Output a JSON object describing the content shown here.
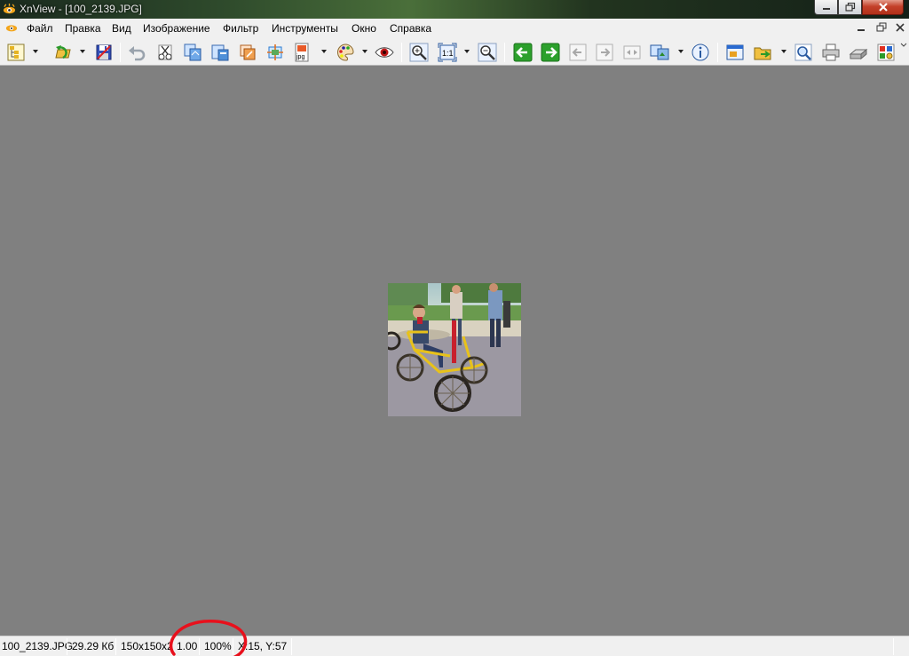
{
  "window": {
    "title": "XnView - [100_2139.JPG]",
    "buttons": {
      "minimize": "minimize-icon",
      "maximize": "restore-icon",
      "close": "close-icon"
    }
  },
  "menubar": {
    "items": [
      "Файл",
      "Правка",
      "Вид",
      "Изображение",
      "Фильтр",
      "Инструменты",
      "Окно",
      "Справка"
    ]
  },
  "toolbar": {
    "format_label": "jpg",
    "zoom_label": "1:1"
  },
  "statusbar": {
    "filename": "100_2139.JPG",
    "filesize": "29.29 Кб",
    "dimensions": "150x150x2",
    "ratio": "1.00",
    "zoom": "100%",
    "coords": "X:15, Y:57"
  },
  "colors": {
    "background": "#808080",
    "annotation": "#e8101c",
    "toolbar": "#f0f0f0"
  },
  "annotation": {
    "shape": "ellipse",
    "target": "ratio-and-zoom"
  }
}
